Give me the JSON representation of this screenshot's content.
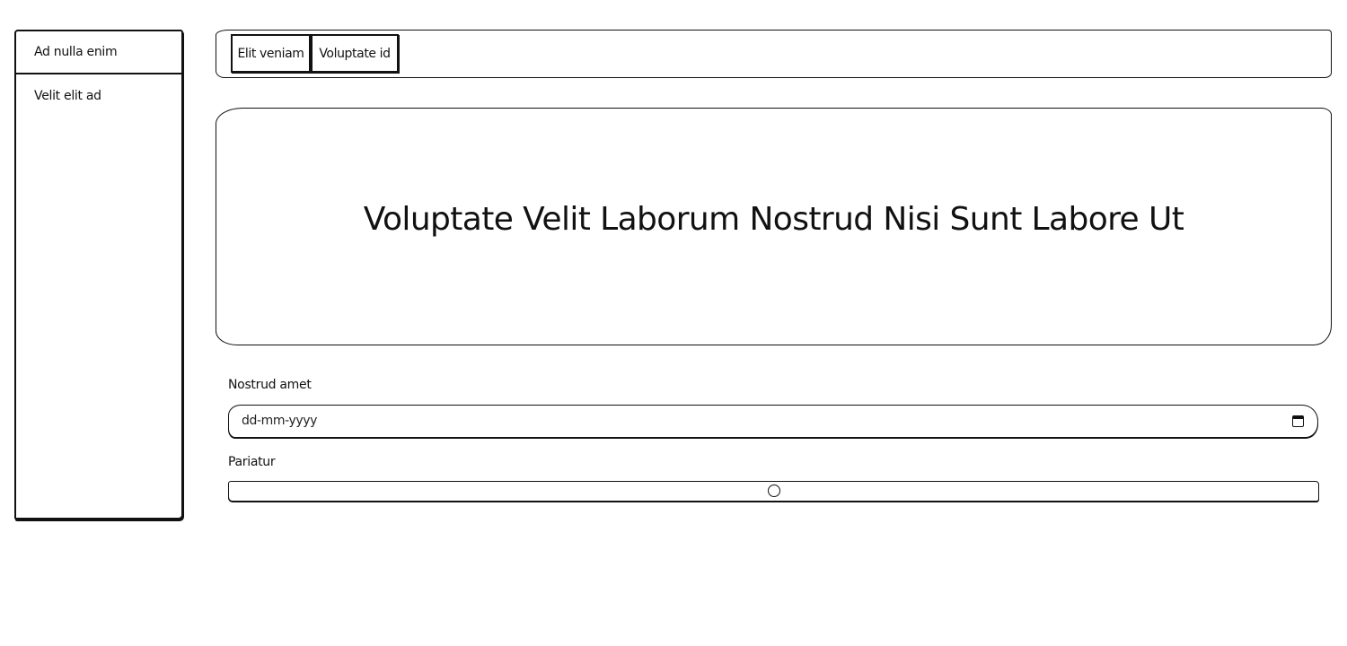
{
  "sidebar": {
    "items": [
      {
        "label": "Ad nulla enim"
      },
      {
        "label": "Velit elit ad"
      }
    ]
  },
  "topbar": {
    "tabs": [
      {
        "label": "Elit veniam"
      },
      {
        "label": "Voluptate id"
      }
    ]
  },
  "hero": {
    "title": "Voluptate Velit Laborum Nostrud Nisi Sunt Labore Ut"
  },
  "form": {
    "date_field": {
      "label": "Nostrud amet",
      "placeholder": "dd-mm-yyyy",
      "icon": "calendar-icon"
    },
    "range_field": {
      "label": "Pariatur",
      "value_fraction": 0.5
    }
  }
}
